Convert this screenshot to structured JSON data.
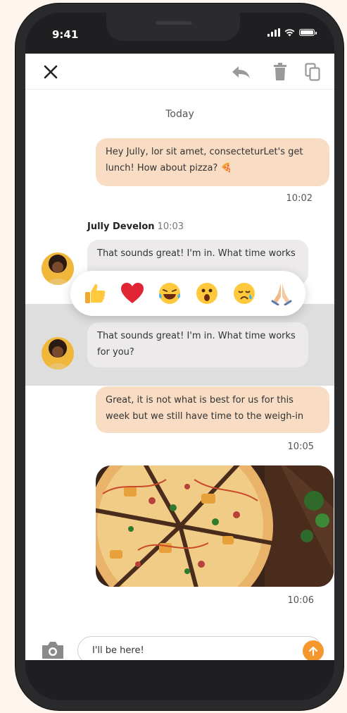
{
  "status_bar": {
    "time": "9:41"
  },
  "day_label": "Today",
  "messages": {
    "m1": {
      "text": "Hey Jully, lor sit amet, consecteturLet's get lunch! How about pizza? 🍕",
      "time": "10:02"
    },
    "m2": {
      "sender": "Jully Develon",
      "time": "10:03",
      "text": "That sounds great! I'm in. What time works"
    },
    "m3": {
      "text": "That sounds great! I'm in. What time works for you?"
    },
    "m4": {
      "text": "Great, it is not what is best for us for this week but we still have time to the weigh-in",
      "time": "10:05"
    },
    "m5": {
      "time": "10:06"
    }
  },
  "reactions": [
    "👍",
    "❤️",
    "😂",
    "😮",
    "😢",
    "🙏"
  ],
  "composer": {
    "value": "I'll be here!"
  },
  "colors": {
    "outgoing_bubble": "#f8dcc3",
    "incoming_bubble": "#eceaea",
    "accent": "#f4972e",
    "highlight": "#dedede"
  },
  "icons": [
    "close-icon",
    "reply-icon",
    "trash-icon",
    "copy-icon",
    "camera-icon",
    "arrow-up-icon",
    "wifi-icon",
    "battery-icon",
    "signal-icon"
  ]
}
